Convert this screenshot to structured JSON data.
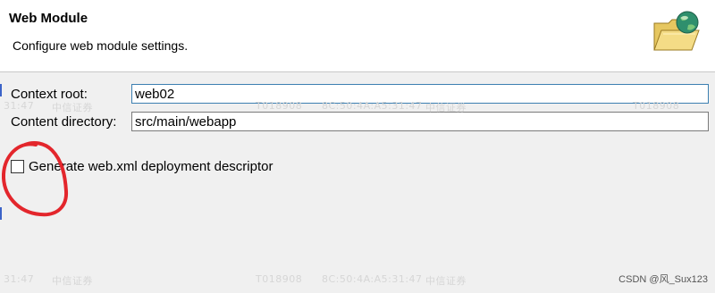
{
  "wizard": {
    "title": "Web Module",
    "description": "Configure web module settings."
  },
  "fields": {
    "context_root_label": "Context root:",
    "context_root_value": "web02",
    "content_dir_label": "Content directory:",
    "content_dir_value": "src/main/webapp"
  },
  "options": {
    "generate_web_xml_label": "Generate web.xml deployment descriptor",
    "generate_web_xml_checked": false
  },
  "watermark": {
    "w1": "31:47",
    "w2": "中信证券",
    "w3": "T018908",
    "w4": "8C:50:4A:A5:31:47",
    "w5": "中信证券",
    "w6": "T018908"
  },
  "credit": "CSDN @风_Sux123",
  "icons": {
    "banner": "web-module-folder-globe-icon"
  }
}
